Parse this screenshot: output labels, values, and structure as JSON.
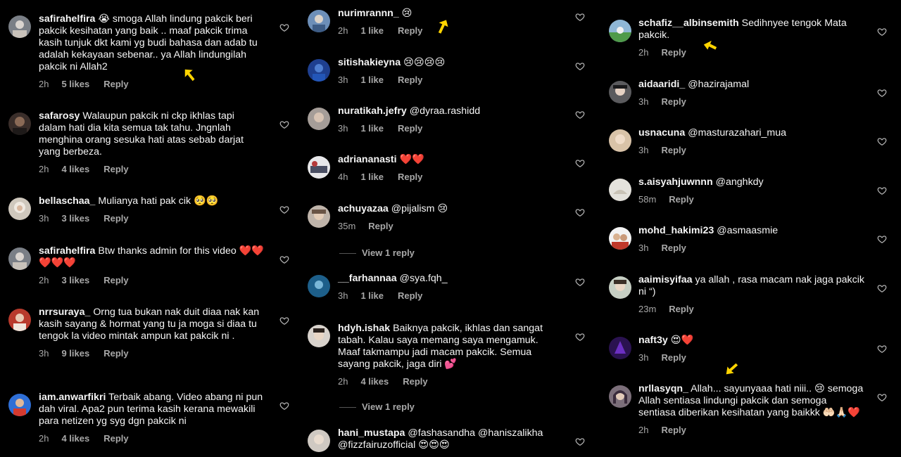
{
  "columns": [
    {
      "comments": [
        {
          "user": "safirahelfira",
          "text": "😭 smoga Allah lindung pakcik beri pakcik kesihatan yang baik .. maaf pakcik trima kasih tunjuk dkt kami yg budi bahasa dan adab tu adalah kekayaan sebenar.. ya Allah lindungilah pakcik ni Allah2",
          "time": "2h",
          "likes": "5 likes",
          "reply": "Reply"
        },
        {
          "user": "safarosy",
          "text": "Walaupun pakcik ni ckp ikhlas tapi dalam hati dia kita semua tak tahu. Jngnlah menghina orang sesuka hati atas sebab darjat yang berbeza.",
          "time": "2h",
          "likes": "4 likes",
          "reply": "Reply"
        },
        {
          "user": "bellaschaa_",
          "text": "Mulianya hati pak cik 🥺🥺",
          "time": "3h",
          "likes": "3 likes",
          "reply": "Reply"
        },
        {
          "user": "safirahelfira",
          "text": "Btw thanks admin for this video ❤️❤️❤️❤️❤️",
          "time": "2h",
          "likes": "3 likes",
          "reply": "Reply"
        },
        {
          "user": "nrrsuraya_",
          "text": "Orng tua bukan nak duit diaa nak kan kasih sayang & hormat yang tu ja moga si diaa tu tengok la video mintak ampun kat pakcik ni .",
          "time": "3h",
          "likes": "9 likes",
          "reply": "Reply"
        },
        {
          "user": "iam.anwarfikri",
          "text": "Terbaik abang. Video abang ni pun dah viral. Apa2 pun terima kasih kerana mewakili para netizen yg syg dgn pakcik ni",
          "time": "2h",
          "likes": "4 likes",
          "reply": "Reply"
        }
      ]
    },
    {
      "comments": [
        {
          "user": "nurimrannn_",
          "text": "😢",
          "time": "2h",
          "likes": "1 like",
          "reply": "Reply"
        },
        {
          "user": "sitishakieyna",
          "text": "😢😢😢😢",
          "time": "3h",
          "likes": "1 like",
          "reply": "Reply"
        },
        {
          "user": "nuratikah.jefry",
          "text": "@dyraa.rashidd",
          "time": "3h",
          "likes": "1 like",
          "reply": "Reply"
        },
        {
          "user": "adriananasti",
          "text": "❤️❤️",
          "time": "4h",
          "likes": "1 like",
          "reply": "Reply"
        },
        {
          "user": "achuyazaa",
          "text": "@pijalism 😢",
          "time": "35m",
          "likes": "",
          "reply": "Reply",
          "view_replies": "View 1 reply"
        },
        {
          "user": "__farhannaa",
          "text": "@sya.fqh_",
          "time": "3h",
          "likes": "1 like",
          "reply": "Reply"
        },
        {
          "user": "hdyh.ishak",
          "text": "Baiknya pakcik, ikhlas dan sangat tabah. Kalau saya memang saya mengamuk. Maaf takmampu jadi macam pakcik. Semua sayang pakcik, jaga diri 💕",
          "time": "2h",
          "likes": "4 likes",
          "reply": "Reply",
          "view_replies": "View 1 reply"
        },
        {
          "user": "hani_mustapa",
          "text": "@fashasandha @haniszalikha @fizzfairuzofficial 😍😍😍",
          "time": "",
          "likes": "",
          "reply": ""
        }
      ]
    },
    {
      "comments": [
        {
          "user": "schafiz__albinsemith",
          "text": "Sedihnyee tengok Mata pakcik.",
          "time": "2h",
          "likes": "",
          "reply": "Reply"
        },
        {
          "user": "aidaaridi_",
          "text": "@hazirajamal",
          "time": "3h",
          "likes": "",
          "reply": "Reply"
        },
        {
          "user": "usnacuna",
          "text": "@masturazahari_mua",
          "time": "3h",
          "likes": "",
          "reply": "Reply"
        },
        {
          "user": "s.aisyahjuwnnn",
          "text": "@anghkdy",
          "time": "58m",
          "likes": "",
          "reply": "Reply"
        },
        {
          "user": "mohd_hakimi23",
          "text": "@asmaasmie",
          "time": "3h",
          "likes": "",
          "reply": "Reply"
        },
        {
          "user": "aaimisyifaa",
          "text": "ya allah , rasa macam nak jaga pakcik ni “)",
          "time": "23m",
          "likes": "",
          "reply": "Reply"
        },
        {
          "user": "naft3y",
          "text": "😍❤️",
          "time": "3h",
          "likes": "",
          "reply": "Reply"
        },
        {
          "user": "nrllasyqn_",
          "text": "Allah... sayunyaaa hati niii.. 😢 semoga Allah sentiasa lindungi pakcik dan semoga sentiasa diberikan kesihatan yang baikkk 🤲🏻🙏🏻❤️",
          "time": "2h",
          "likes": "",
          "reply": "Reply"
        }
      ]
    }
  ],
  "colors": {
    "background": "#000000",
    "text": "#f5f5f5",
    "muted": "#a8a8a8",
    "arrow": "#ffd400"
  },
  "icons": {
    "like": "heart-outline-icon",
    "annotation": "yellow-arrow-icon"
  }
}
